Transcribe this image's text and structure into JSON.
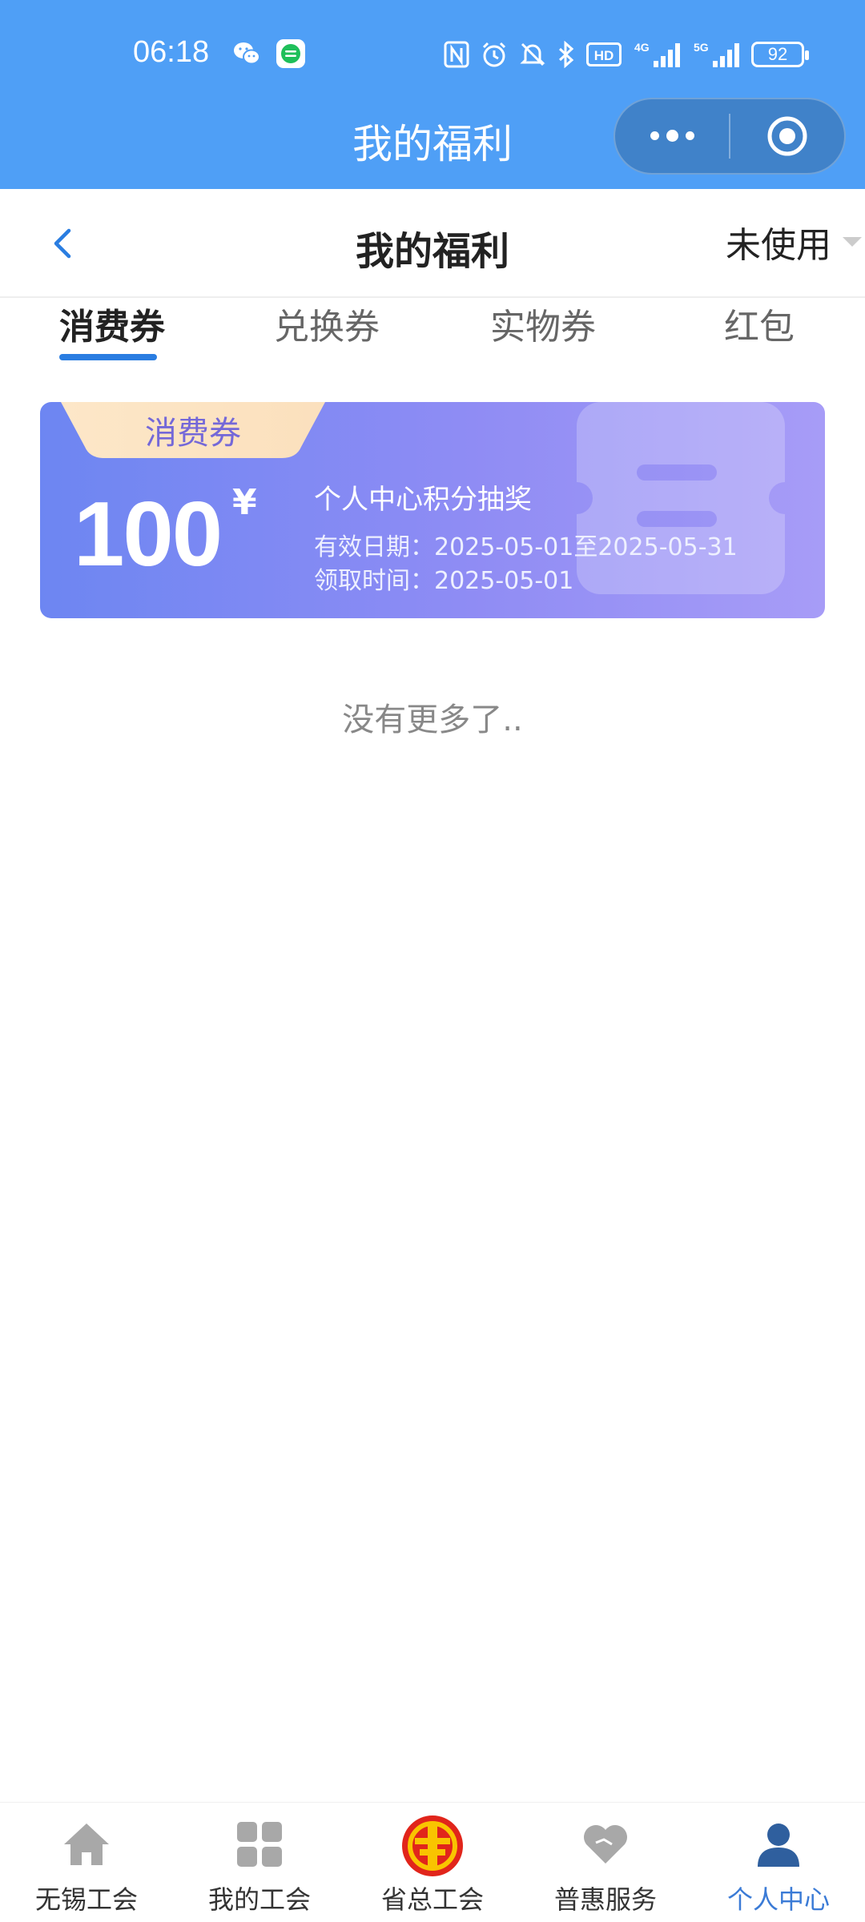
{
  "status_bar": {
    "time": "06:18",
    "left_icons": [
      "wechat-icon",
      "message-app-icon"
    ],
    "right_icons": [
      "nfc-icon",
      "alarm-icon",
      "mute-icon",
      "bluetooth-icon",
      "hd-icon",
      "4g-signal-icon",
      "5g-signal-icon",
      "battery-icon"
    ],
    "network_4g": "4G",
    "network_5g": "5G",
    "hd_label": "HD",
    "battery_level": "92"
  },
  "mini_program": {
    "title": "我的福利"
  },
  "navbar": {
    "title": "我的福利",
    "filter_label": "未使用"
  },
  "tabs": [
    {
      "label": "消费券",
      "active": true
    },
    {
      "label": "兑换券",
      "active": false
    },
    {
      "label": "实物券",
      "active": false
    },
    {
      "label": "红包",
      "active": false
    }
  ],
  "coupons": [
    {
      "tag": "消费券",
      "amount": "100",
      "currency": "¥",
      "name": "个人中心积分抽奖",
      "valid_period": "有效日期：2025-05-01至2025-05-31",
      "received_time": "领取时间：2025-05-01"
    }
  ],
  "list_end_text": "没有更多了..",
  "bottom_tabs": [
    {
      "label": "无锡工会",
      "icon": "home-icon",
      "active": false
    },
    {
      "label": "我的工会",
      "icon": "grid-icon",
      "active": false
    },
    {
      "label": "省总工会",
      "icon": "union-logo-icon",
      "active": false
    },
    {
      "label": "普惠服务",
      "icon": "heart-icon",
      "active": false
    },
    {
      "label": "个人中心",
      "icon": "person-icon",
      "active": true
    }
  ],
  "colors": {
    "header_blue": "#4f9ff6",
    "tab_active_underline": "#2a7de1",
    "coupon_gradient_start": "#6d86f2",
    "coupon_gradient_end": "#a79cf7",
    "bottom_tab_active": "#3b7bd6"
  }
}
